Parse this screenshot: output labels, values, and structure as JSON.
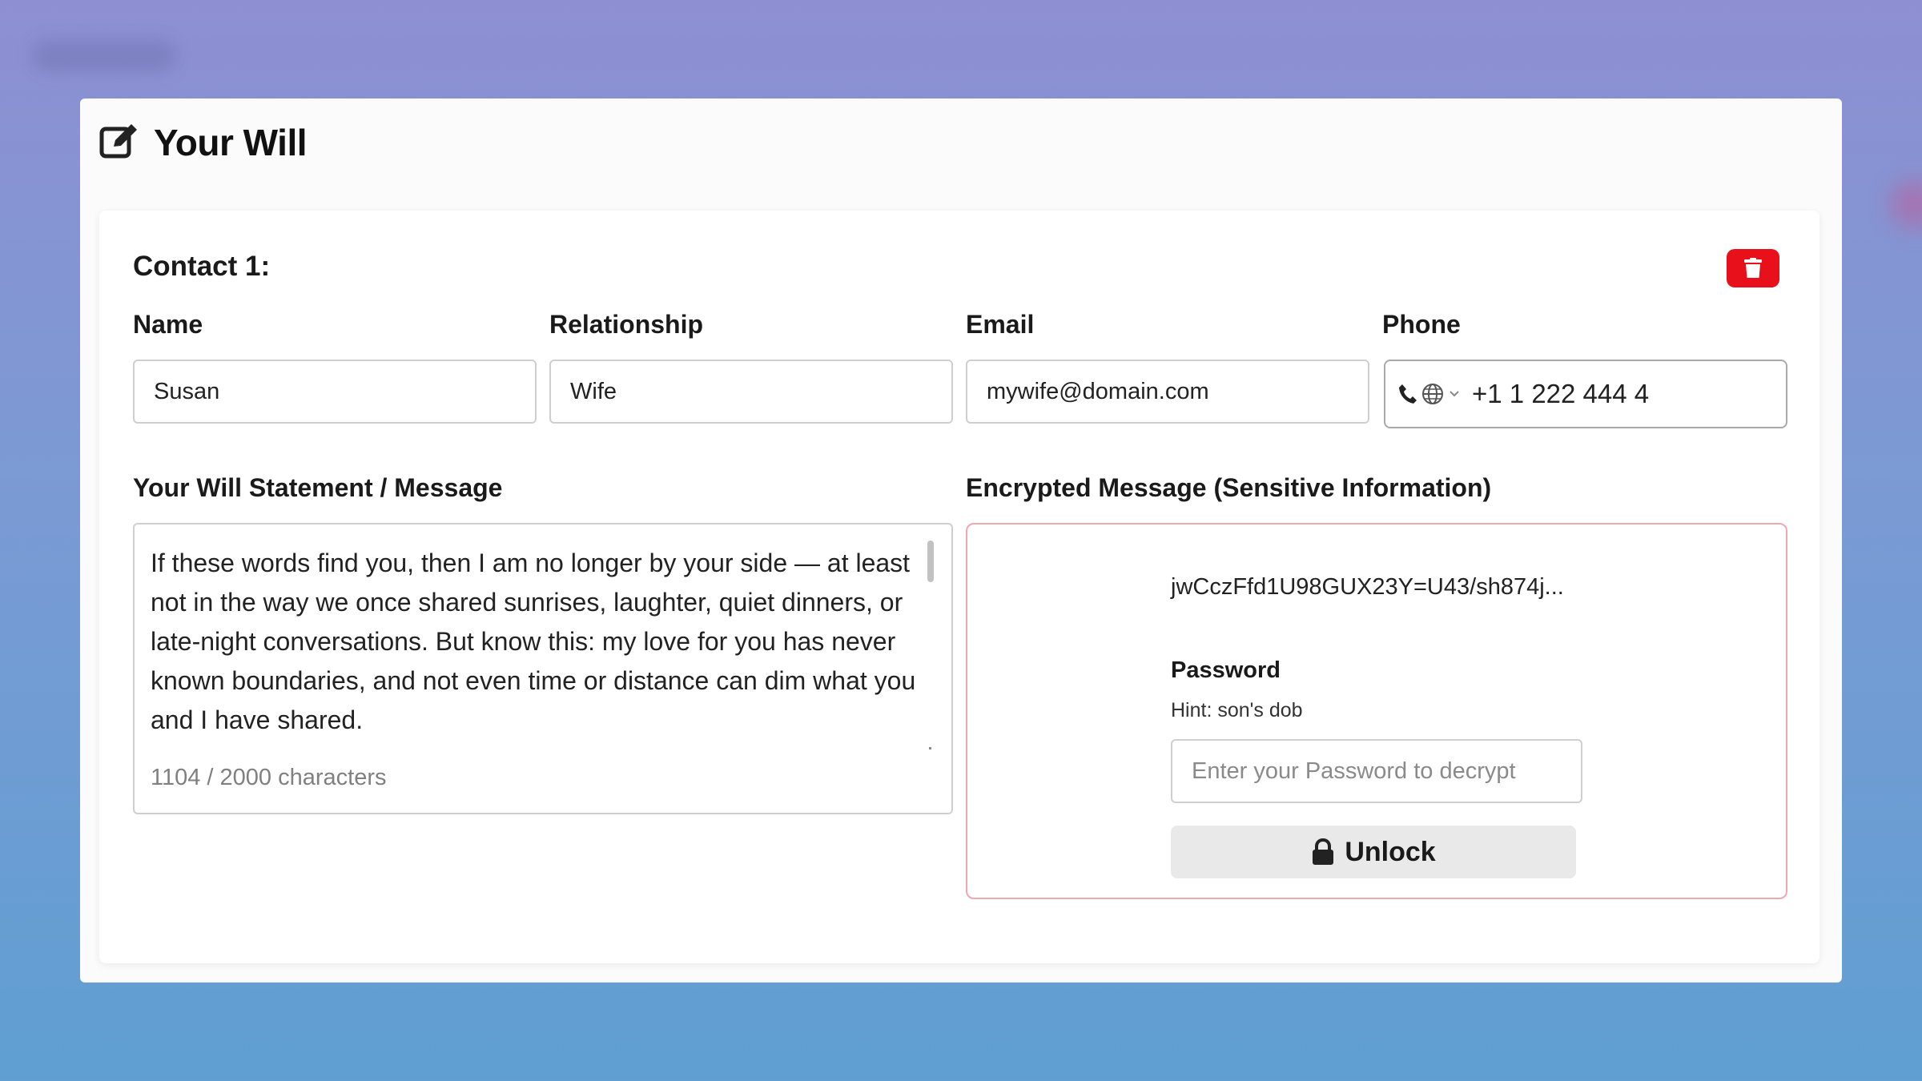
{
  "page": {
    "title": "Your Will"
  },
  "contact": {
    "title": "Contact 1:",
    "fields": {
      "name": {
        "label": "Name",
        "value": "Susan"
      },
      "relationship": {
        "label": "Relationship",
        "value": "Wife"
      },
      "email": {
        "label": "Email",
        "value": "mywife@domain.com"
      },
      "phone": {
        "label": "Phone",
        "value": "+1 1 222 444 4"
      }
    }
  },
  "statement": {
    "label": "Your Will Statement / Message",
    "text": "If these words find you, then I am no longer by your side — at least not in the way we once shared sunrises, laughter, quiet dinners, or late-night conversations. But know this: my love for you has never known boundaries, and not even time or distance can dim what you and I have shared.",
    "char_count": "1104 / 2000 characters"
  },
  "encrypted": {
    "label": "Encrypted Message (Sensitive Information)",
    "cipher": "jwCczFfd1U98GUX23Y=U43/sh874j...",
    "password_label": "Password",
    "hint": "Hint: son's dob",
    "password_placeholder": "Enter your Password to decrypt",
    "unlock_label": "Unlock"
  },
  "colors": {
    "delete": "#e8101a",
    "encrypted_border": "#f1a7b0",
    "unlock_bg": "#e9e9e9"
  },
  "icons": {
    "title": "edit-icon",
    "delete": "trash-icon",
    "phone": "phone-icon",
    "country": "globe-icon",
    "dropdown": "chevron-down-icon",
    "unlock": "lock-icon"
  }
}
